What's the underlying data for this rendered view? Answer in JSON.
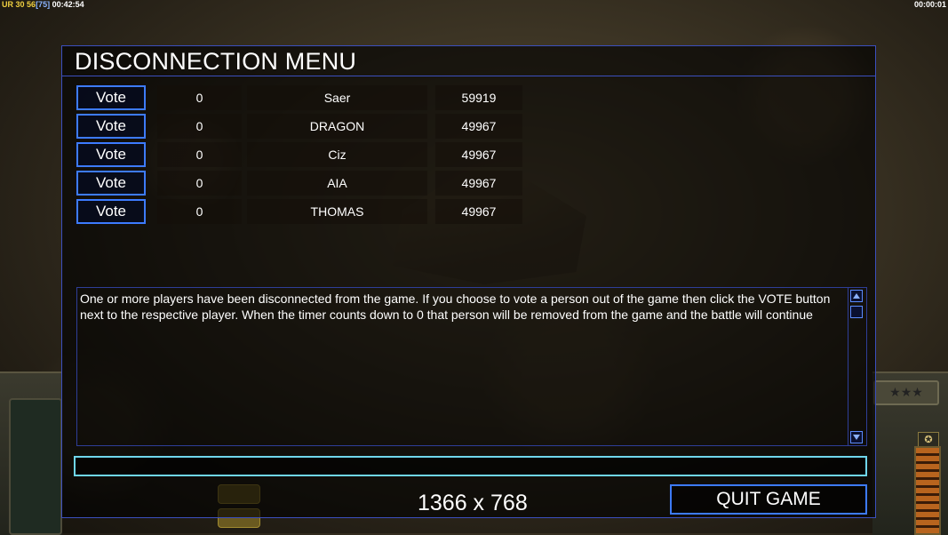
{
  "overlay": {
    "top_left": {
      "ur": "UR",
      "num1": "30",
      "num2": "56",
      "bracket": "[75]",
      "clock": "00:42:54"
    },
    "top_right_clock": "00:00:01"
  },
  "dialog": {
    "title": "DISCONNECTION MENU",
    "players": [
      {
        "vote_label": "Vote",
        "timer": "0",
        "name": "Saer",
        "ping": "59919"
      },
      {
        "vote_label": "Vote",
        "timer": "0",
        "name": "DRAGON",
        "ping": "49967"
      },
      {
        "vote_label": "Vote",
        "timer": "0",
        "name": "Ciz",
        "ping": "49967"
      },
      {
        "vote_label": "Vote",
        "timer": "0",
        "name": "AIA",
        "ping": "49967"
      },
      {
        "vote_label": "Vote",
        "timer": "0",
        "name": "THOMAS",
        "ping": "49967"
      }
    ],
    "message": "One or more players have been disconnected from the game. If you choose to vote a person out of the game then click the VOTE button next to the respective player. When the timer counts down to 0 that person will be removed from the game and the battle will continue",
    "chat_value": "",
    "resolution": "1366 x 768",
    "quit_label": "QUIT GAME"
  },
  "icons": {
    "scroll_up": "arrow-up-icon",
    "scroll_down": "arrow-down-icon",
    "stars": "★★★"
  },
  "colors": {
    "accent_border": "#3d7bff",
    "input_border": "#6fd6ec",
    "resource_yellow": "#f0d040"
  }
}
